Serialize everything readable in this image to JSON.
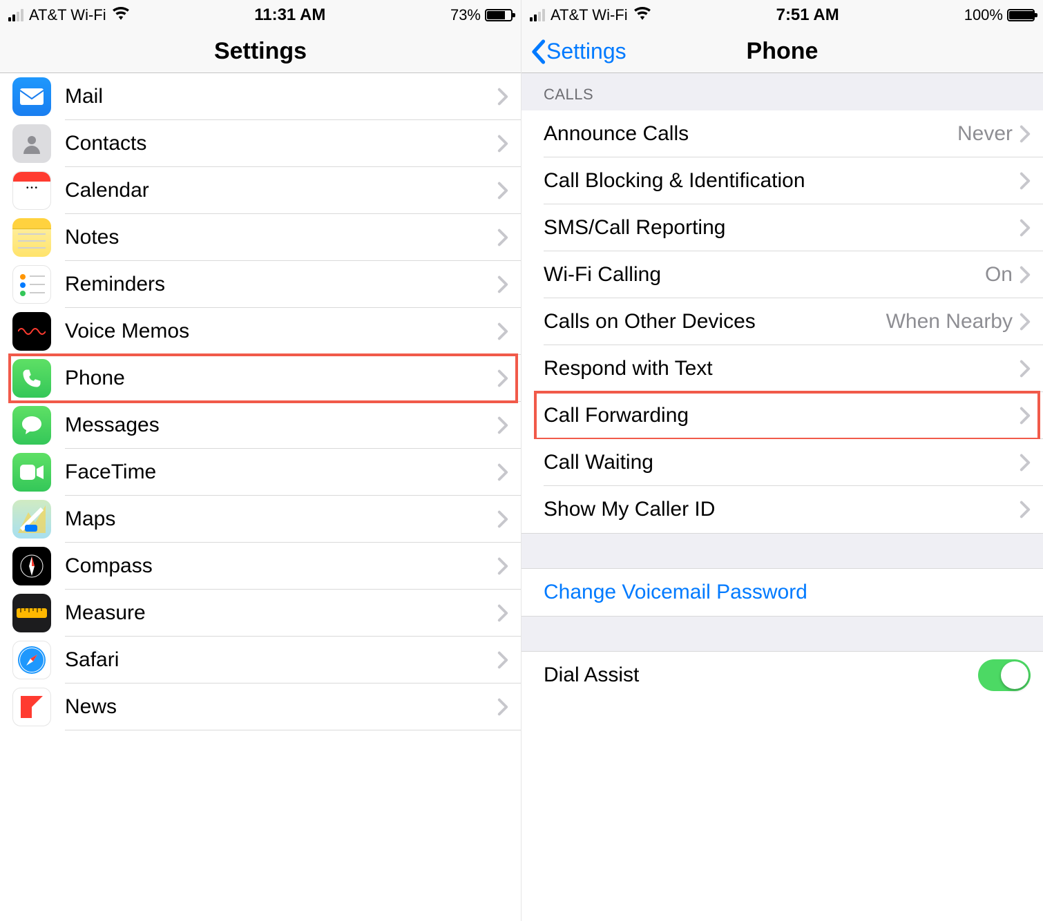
{
  "left": {
    "status": {
      "carrier": "AT&T Wi-Fi",
      "time": "11:31 AM",
      "battery_pct": "73%",
      "battery_fill": 73
    },
    "nav": {
      "title": "Settings"
    },
    "items": [
      {
        "id": "mail",
        "label": "Mail",
        "icon": "mail-icon",
        "icon_class": "ic-mail"
      },
      {
        "id": "contacts",
        "label": "Contacts",
        "icon": "contacts-icon",
        "icon_class": "ic-contacts"
      },
      {
        "id": "calendar",
        "label": "Calendar",
        "icon": "calendar-icon",
        "icon_class": "ic-calendar"
      },
      {
        "id": "notes",
        "label": "Notes",
        "icon": "notes-icon",
        "icon_class": "ic-notes"
      },
      {
        "id": "reminders",
        "label": "Reminders",
        "icon": "reminders-icon",
        "icon_class": "ic-reminders"
      },
      {
        "id": "voice-memos",
        "label": "Voice Memos",
        "icon": "voice-memos-icon",
        "icon_class": "ic-voicememos"
      },
      {
        "id": "phone",
        "label": "Phone",
        "icon": "phone-icon",
        "icon_class": "ic-phone",
        "highlighted": true
      },
      {
        "id": "messages",
        "label": "Messages",
        "icon": "messages-icon",
        "icon_class": "ic-messages"
      },
      {
        "id": "facetime",
        "label": "FaceTime",
        "icon": "facetime-icon",
        "icon_class": "ic-facetime"
      },
      {
        "id": "maps",
        "label": "Maps",
        "icon": "maps-icon",
        "icon_class": "ic-maps"
      },
      {
        "id": "compass",
        "label": "Compass",
        "icon": "compass-icon",
        "icon_class": "ic-compass"
      },
      {
        "id": "measure",
        "label": "Measure",
        "icon": "measure-icon",
        "icon_class": "ic-measure"
      },
      {
        "id": "safari",
        "label": "Safari",
        "icon": "safari-icon",
        "icon_class": "ic-safari"
      },
      {
        "id": "news",
        "label": "News",
        "icon": "news-icon",
        "icon_class": "ic-news"
      }
    ]
  },
  "right": {
    "status": {
      "carrier": "AT&T Wi-Fi",
      "time": "7:51 AM",
      "battery_pct": "100%",
      "battery_fill": 100
    },
    "nav": {
      "back": "Settings",
      "title": "Phone"
    },
    "section_header": "CALLS",
    "rows": [
      {
        "id": "announce-calls",
        "label": "Announce Calls",
        "value": "Never"
      },
      {
        "id": "call-blocking",
        "label": "Call Blocking & Identification",
        "value": ""
      },
      {
        "id": "sms-call-reporting",
        "label": "SMS/Call Reporting",
        "value": ""
      },
      {
        "id": "wifi-calling",
        "label": "Wi-Fi Calling",
        "value": "On"
      },
      {
        "id": "calls-other-devices",
        "label": "Calls on Other Devices",
        "value": "When Nearby"
      },
      {
        "id": "respond-with-text",
        "label": "Respond with Text",
        "value": ""
      },
      {
        "id": "call-forwarding",
        "label": "Call Forwarding",
        "value": "",
        "highlighted": true
      },
      {
        "id": "call-waiting",
        "label": "Call Waiting",
        "value": ""
      },
      {
        "id": "show-caller-id",
        "label": "Show My Caller ID",
        "value": ""
      }
    ],
    "voicemail_row": {
      "label": "Change Voicemail Password"
    },
    "dial_assist": {
      "label": "Dial Assist",
      "on": true
    }
  }
}
